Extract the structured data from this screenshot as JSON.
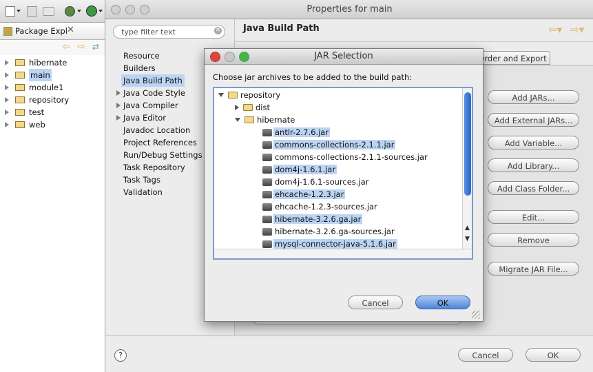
{
  "package_explorer": {
    "tab_label": "Package Expl",
    "projects": [
      "hibernate",
      "main",
      "module1",
      "repository",
      "test",
      "web"
    ],
    "selected": "main"
  },
  "properties": {
    "window_title": "Properties for main",
    "filter_placeholder": "type filter text",
    "nav_items": [
      {
        "label": "Resource",
        "expandable": false
      },
      {
        "label": "Builders",
        "expandable": false
      },
      {
        "label": "Java Build Path",
        "expandable": false
      },
      {
        "label": "Java Code Style",
        "expandable": true
      },
      {
        "label": "Java Compiler",
        "expandable": true
      },
      {
        "label": "Java Editor",
        "expandable": true
      },
      {
        "label": "Javadoc Location",
        "expandable": false
      },
      {
        "label": "Project References",
        "expandable": false
      },
      {
        "label": "Run/Debug Settings",
        "expandable": false
      },
      {
        "label": "Task Repository",
        "expandable": false
      },
      {
        "label": "Task Tags",
        "expandable": false
      },
      {
        "label": "Validation",
        "expandable": false
      }
    ],
    "selected_nav": "Java Build Path",
    "page_title": "Java Build Path",
    "tab_order_export": "Order and Export",
    "side_buttons": [
      "Add JARs...",
      "Add External JARs...",
      "Add Variable...",
      "Add Library...",
      "Add Class Folder...",
      "Edit...",
      "Remove",
      "Migrate JAR File..."
    ],
    "cancel_label": "Cancel",
    "ok_label": "OK",
    "help_label": "?"
  },
  "jar_dialog": {
    "title": "JAR Selection",
    "instruction": "Choose jar archives to be added to the build path:",
    "root": "repository",
    "dist_folder": "dist",
    "hibernate_folder": "hibernate",
    "files": [
      {
        "name": "antlr-2.7.6.jar",
        "selected": true
      },
      {
        "name": "commons-collections-2.1.1.jar",
        "selected": true
      },
      {
        "name": "commons-collections-2.1.1-sources.jar",
        "selected": false
      },
      {
        "name": "dom4j-1.6.1.jar",
        "selected": true
      },
      {
        "name": "dom4j-1.6.1-sources.jar",
        "selected": false
      },
      {
        "name": "ehcache-1.2.3.jar",
        "selected": true
      },
      {
        "name": "ehcache-1.2.3-sources.jar",
        "selected": false
      },
      {
        "name": "hibernate-3.2.6.ga.jar",
        "selected": true
      },
      {
        "name": "hibernate-3.2.6.ga-sources.jar",
        "selected": false
      },
      {
        "name": "mysql-connector-java-5.1.6.jar",
        "selected": true
      }
    ],
    "cancel_label": "Cancel",
    "ok_label": "OK"
  },
  "colors": {
    "selection": "#bcd4f3",
    "ok_button": "#6d9fe3",
    "close_red": "#e0443e",
    "minimize_yellow": "#c9c9c9",
    "maximize_green": "#4ab43f"
  }
}
